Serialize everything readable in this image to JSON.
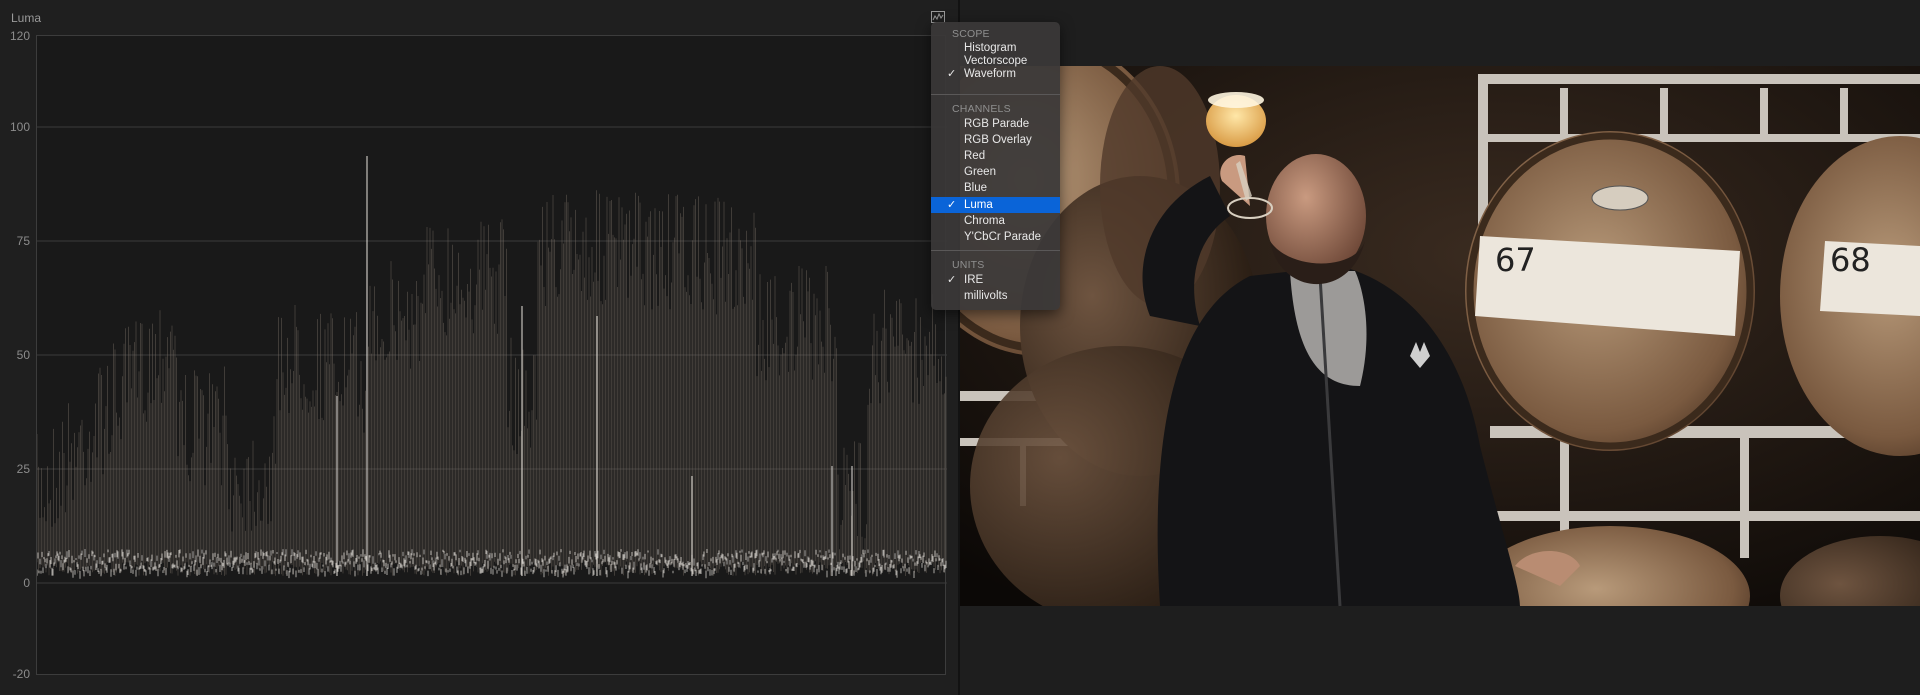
{
  "scope": {
    "title": "Luma",
    "settings_icon": "scope-settings-icon",
    "ire_scale": [
      "120",
      "100",
      "75",
      "50",
      "25",
      "0",
      "-20"
    ]
  },
  "menu": {
    "scope_header": "SCOPE",
    "scope_items": [
      {
        "label": "Histogram",
        "checked": false
      },
      {
        "label": "Vectorscope",
        "checked": false
      },
      {
        "label": "Waveform",
        "checked": true
      }
    ],
    "channels_header": "CHANNELS",
    "channel_items": [
      {
        "label": "RGB Parade",
        "checked": false
      },
      {
        "label": "RGB Overlay",
        "checked": false
      },
      {
        "label": "Red",
        "checked": false
      },
      {
        "label": "Green",
        "checked": false
      },
      {
        "label": "Blue",
        "checked": false
      },
      {
        "label": "Luma",
        "checked": true,
        "highlighted": true
      },
      {
        "label": "Chroma",
        "checked": false
      },
      {
        "label": "Y'CbCr Parade",
        "checked": false
      }
    ],
    "units_header": "UNITS",
    "unit_items": [
      {
        "label": "IRE",
        "checked": true
      },
      {
        "label": "millivolts",
        "checked": false
      }
    ],
    "check_glyph": "✓",
    "highlight_color": "#0a64d8"
  },
  "viewer": {
    "barrel_numbers": [
      "67",
      "68"
    ]
  }
}
